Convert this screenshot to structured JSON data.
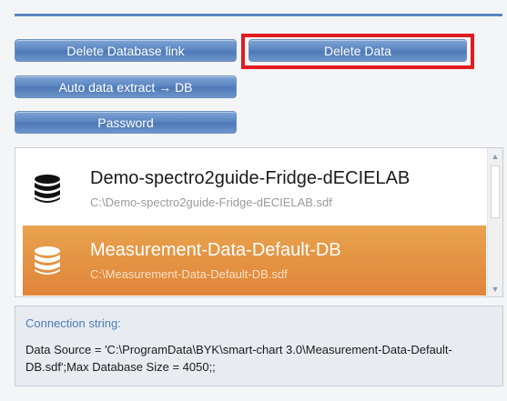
{
  "buttons": {
    "delete_db_link": "Delete Database link",
    "delete_data": "Delete Data",
    "auto_extract": "Auto data extract → DB",
    "password": "Password"
  },
  "database_list": {
    "items": [
      {
        "name": "Demo-spectro2guide-Fridge-dECIELAB",
        "path": "C:\\Demo-spectro2guide-Fridge-dECIELAB.sdf",
        "icon": "database-icon",
        "selected": false
      },
      {
        "name": "Measurement-Data-Default-DB",
        "path": "C:\\Measurement-Data-Default-DB.sdf",
        "icon": "database-icon",
        "selected": true
      }
    ]
  },
  "connection": {
    "label": "Connection string:",
    "value": "Data Source = 'C:\\ProgramData\\BYK\\smart-chart 3.0\\Measurement-Data-Default-DB.sdf';Max Database Size = 4050;;"
  },
  "colors": {
    "accent": "#5a86c2",
    "highlight": "#e21b22",
    "selected": "#e0843a"
  }
}
